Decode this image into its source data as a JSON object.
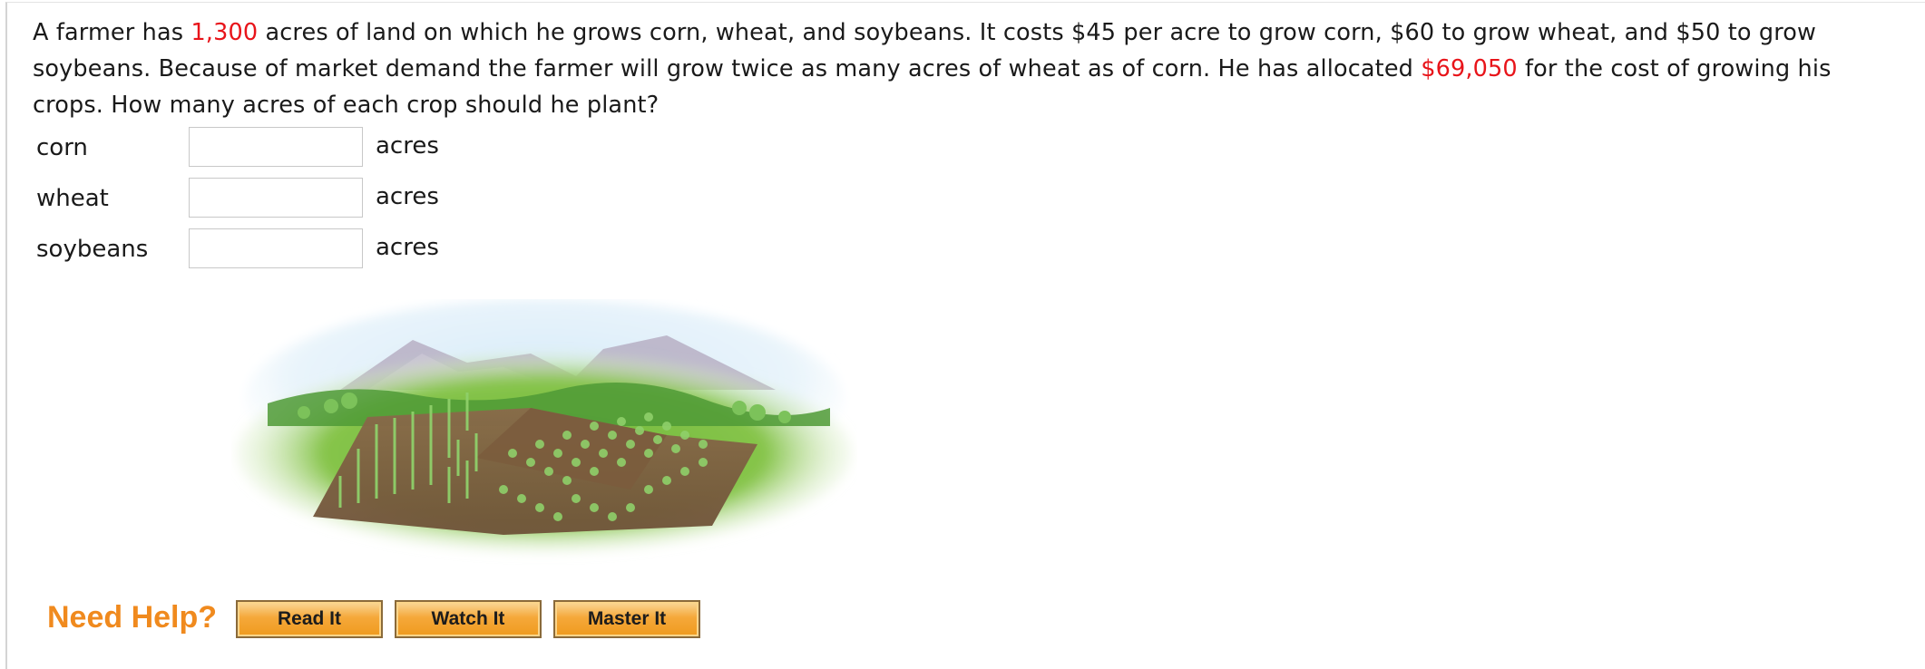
{
  "question": {
    "part1": "A farmer has ",
    "acres_total": "1,300",
    "part2": " acres of land on which he grows corn, wheat, and soybeans. It costs $45 per acre to grow corn, $60 to grow wheat, and $50 to grow soybeans. Because of market demand the farmer will grow twice as many acres of wheat as of corn. He has allocated ",
    "budget": "$69,050",
    "part3": " for the cost of growing his crops. How many acres of each crop should he plant?"
  },
  "answers": [
    {
      "label": "corn",
      "value": "",
      "unit": "acres"
    },
    {
      "label": "wheat",
      "value": "",
      "unit": "acres"
    },
    {
      "label": "soybeans",
      "value": "",
      "unit": "acres"
    }
  ],
  "help": {
    "title": "Need Help?",
    "buttons": [
      "Read It",
      "Watch It",
      "Master It"
    ]
  },
  "colors": {
    "highlight": "#e8141a",
    "help_title": "#f08a1e",
    "button_fill": "#f5a83a"
  },
  "illustration": {
    "icon": "farm-field-illustration"
  }
}
